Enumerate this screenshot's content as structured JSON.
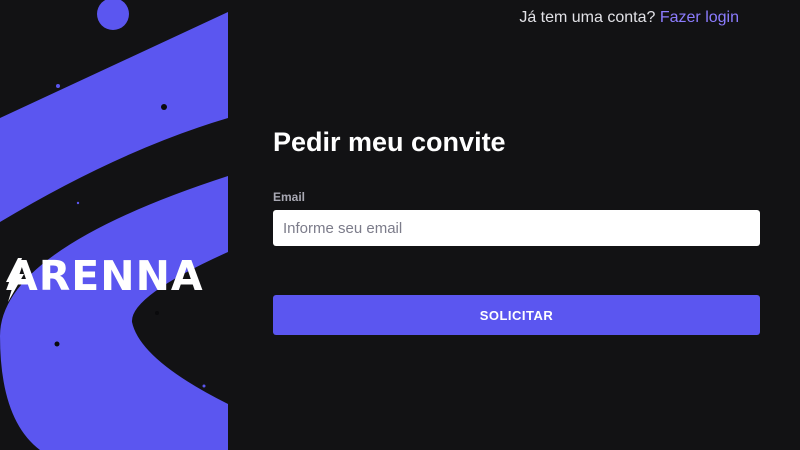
{
  "brand": {
    "logo_text": "ARENNA",
    "accent_color": "#5b56f0",
    "background_color": "#121214"
  },
  "header": {
    "account_question": "Já tem uma conta?",
    "login_link": "Fazer login"
  },
  "form": {
    "title": "Pedir meu convite",
    "email_label": "Email",
    "email_value": "",
    "email_placeholder": "Informe seu email",
    "submit_label": "SOLICITAR"
  },
  "icons": {
    "logo_bolt": "lightning-bolt-icon"
  }
}
